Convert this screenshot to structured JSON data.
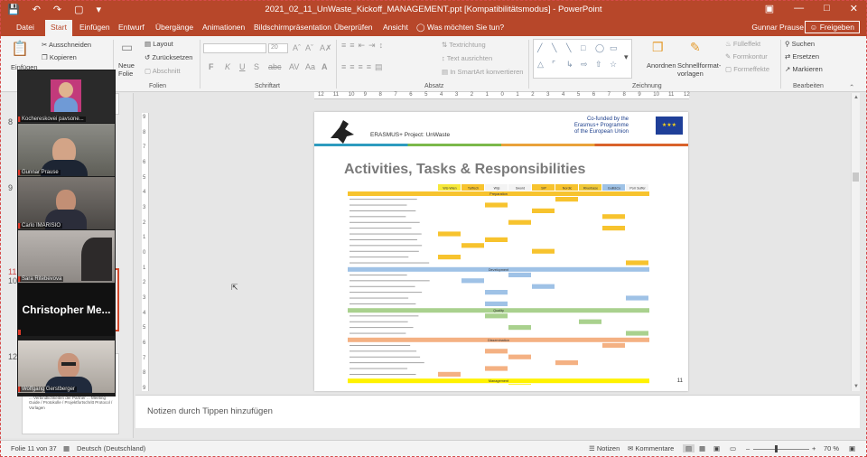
{
  "window": {
    "title": "2021_02_11_UnWaste_Kickoff_MANAGEMENT.ppt [Kompatibilitätsmodus] - PowerPoint",
    "user": "Gunnar Prause",
    "share_label": "Freigeben"
  },
  "tabs": [
    "Datei",
    "Start",
    "Einfügen",
    "Entwurf",
    "Übergänge",
    "Animationen",
    "Bildschirmpräsentation",
    "Überprüfen",
    "Ansicht"
  ],
  "active_tab": "Start",
  "tell_me_placeholder": "Was möchten Sie tun?",
  "ribbon": {
    "paste": "Einfügen",
    "cut": "Ausschneiden",
    "copy": "Kopieren",
    "new_slide": "Neue Folie",
    "layout": "Layout",
    "reset": "Zurücksetzen",
    "section": "Abschnitt",
    "font_size": "20",
    "text_direction": "Textrichtung",
    "align_text": "Text ausrichten",
    "smartart": "In SmartArt konvertieren",
    "arrange": "Anordnen",
    "quick_styles": "Schnellformat-vorlagen",
    "fill": "Fülleffekt",
    "outline": "Formkontur",
    "effects": "Formeffekte",
    "find": "Suchen",
    "replace": "Ersetzen",
    "select": "Markieren",
    "groups": {
      "slides": "Folien",
      "font": "Schriftart",
      "paragraph": "Absatz",
      "drawing": "Zeichnung",
      "editing": "Bearbeiten"
    }
  },
  "thumbnails": {
    "numbers": [
      "8",
      "9",
      "10",
      "11",
      "12"
    ],
    "active": "11",
    "preview_text": "Gestaltung der Projektlaufzeit mit einer Sitzung ... Verbindlichkeiten der Partner ... Meeting Guide / Protokolle / Projektfortschritt Protocol / Vorlagen"
  },
  "participants": [
    {
      "name": "Kochereskovei pavsone...",
      "type": "video"
    },
    {
      "name": "Gunnar Prause",
      "type": "video"
    },
    {
      "name": "Carlo IMARISIO",
      "type": "video"
    },
    {
      "name": "Sara Ritebevova",
      "type": "video"
    },
    {
      "name": "Christopher Me...",
      "type": "name"
    },
    {
      "name": "Wolfgang Gerstberger",
      "type": "video"
    }
  ],
  "ruler": {
    "horizontal": [
      "12",
      "11",
      "10",
      "9",
      "8",
      "7",
      "6",
      "5",
      "4",
      "3",
      "2",
      "1",
      "0",
      "1",
      "2",
      "3",
      "4",
      "5",
      "6",
      "7",
      "8",
      "9",
      "10",
      "11",
      "12"
    ],
    "vertical": [
      "9",
      "8",
      "7",
      "6",
      "5",
      "4",
      "3",
      "2",
      "1",
      "0",
      "1",
      "2",
      "3",
      "4",
      "5",
      "6",
      "7",
      "8",
      "9"
    ]
  },
  "slide": {
    "project_label": "ERASMUS+ Project: UnWaste",
    "funded_by": [
      "Co-funded by the",
      "Erasmus+ Programme",
      "of the European Union"
    ],
    "title": "Activities, Tasks & Responsibilities",
    "page_number": "11",
    "colorbar": [
      "#2d9bbf",
      "#7bb84a",
      "#e9a23a",
      "#d9622b"
    ],
    "gantt": {
      "partners": [
        "WU-Wien",
        "TalTech",
        "Wijs",
        "Sword",
        "SIP",
        "Nordic",
        "Riverbase",
        "Gulli&Co",
        "Porr Suffer"
      ],
      "partner_colors": [
        "#f6e83a",
        "#f7c32e",
        "#f3f3f3",
        "#f3f3f3",
        "#f7c32e",
        "#f7c32e",
        "#f0c93a",
        "#9fc2e6",
        "#f3f3f3"
      ],
      "sections": [
        {
          "name": "Preparation",
          "color": "#f7c32e",
          "rows": 12
        },
        {
          "name": "Development",
          "color": "#9fc2e6",
          "rows": 6
        },
        {
          "name": "Quality",
          "color": "#a9d18e",
          "rows": 4
        },
        {
          "name": "Dissemination",
          "color": "#f4b183",
          "rows": 6
        },
        {
          "name": "Management",
          "color": "#fff200",
          "rows": 4
        }
      ]
    }
  },
  "notes_placeholder": "Notizen durch Tippen hinzufügen",
  "status": {
    "slide_info": "Folie 11 von 37",
    "language": "Deutsch (Deutschland)",
    "notes": "Notizen",
    "comments": "Kommentare",
    "zoom": "70 %"
  }
}
